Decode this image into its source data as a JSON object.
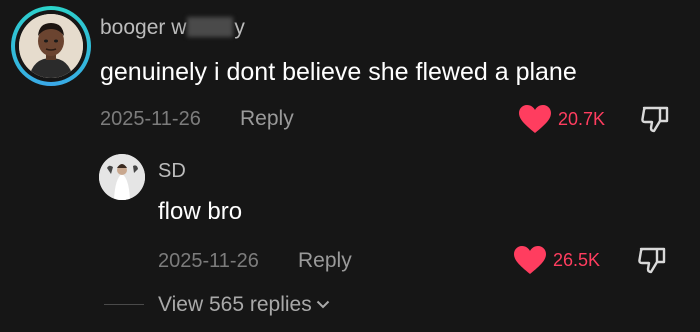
{
  "comments": [
    {
      "username_start": "booger w",
      "username_end": "y",
      "text": "genuinely i dont believe she flewed a plane",
      "date": "2025-11-26",
      "reply_label": "Reply",
      "likes": "20.7K"
    },
    {
      "username": "SD",
      "text": "flow bro",
      "date": "2025-11-26",
      "reply_label": "Reply",
      "likes": "26.5K"
    }
  ],
  "view_replies_label": "View 565 replies",
  "icons": {
    "like": "heart-icon",
    "dislike": "thumbs-down-icon",
    "expand": "chevron-down-icon"
  },
  "colors": {
    "background": "#161616",
    "like": "#ff3d5f",
    "avatar_ring": "#2ad4c8"
  }
}
